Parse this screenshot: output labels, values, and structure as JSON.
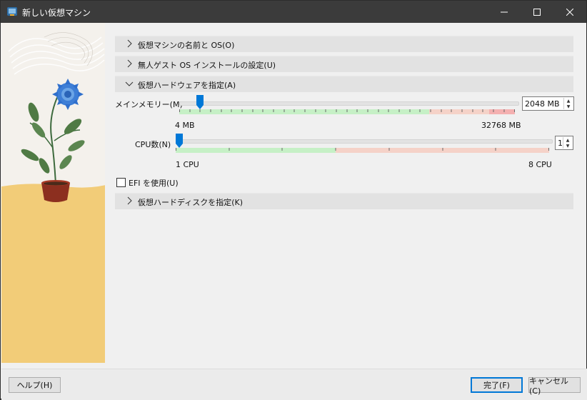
{
  "window": {
    "title": "新しい仮想マシン"
  },
  "sections": [
    {
      "label": "仮想マシンの名前と OS(O)",
      "expanded": false
    },
    {
      "label": "無人ゲスト OS インストールの設定(U)",
      "expanded": false
    },
    {
      "label": "仮想ハードウェアを指定(A)",
      "expanded": true
    },
    {
      "label": "仮想ハードディスクを指定(K)",
      "expanded": false
    }
  ],
  "memory": {
    "label": "メインメモリー(M)",
    "value": "2048 MB",
    "min_label": "4 MB",
    "max_label": "32768 MB"
  },
  "cpu": {
    "label": "CPU数(N)",
    "value": "1",
    "min_label": "1 CPU",
    "max_label": "8 CPU"
  },
  "efi": {
    "label": "EFI を使用(U)",
    "checked": false
  },
  "buttons": {
    "help": "ヘルプ(H)",
    "finish": "完了(F)",
    "cancel": "キャンセル(C)"
  },
  "colors": {
    "titlebar": "#3b3b3b",
    "accent": "#0078d7",
    "scale_good": "#c6f0c6",
    "scale_warn": "#f5d2c8",
    "scale_bad": "#f4b0b0",
    "illustration_floor": "#f2cc78"
  }
}
